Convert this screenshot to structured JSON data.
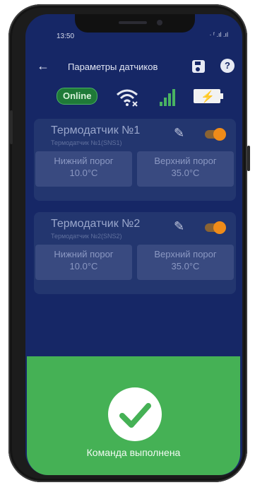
{
  "status": {
    "time": "13:50",
    "icons": "· ᶠ .ıl .ıl"
  },
  "appbar": {
    "title": "Параметры датчиков",
    "help": "?"
  },
  "connection": {
    "online_label": "Online"
  },
  "colors": {
    "background": "#162766",
    "card": "#23366f",
    "success": "#45b155",
    "toggle": "#ef8b19"
  },
  "sensors": [
    {
      "name": "Термодатчик №1",
      "subtitle": "Термодатчик №1(SNS1)",
      "lower_label": "Нижний порог",
      "lower_value": "10.0°C",
      "upper_label": "Верхний порог",
      "upper_value": "35.0°C",
      "enabled": true
    },
    {
      "name": "Термодатчик №2",
      "subtitle": "Термодатчик №2(SNS2)",
      "lower_label": "Нижний порог",
      "lower_value": "10.0°C",
      "upper_label": "Верхний порог",
      "upper_value": "35.0°C",
      "enabled": true
    }
  ],
  "result": {
    "message": "Команда выполнена"
  }
}
